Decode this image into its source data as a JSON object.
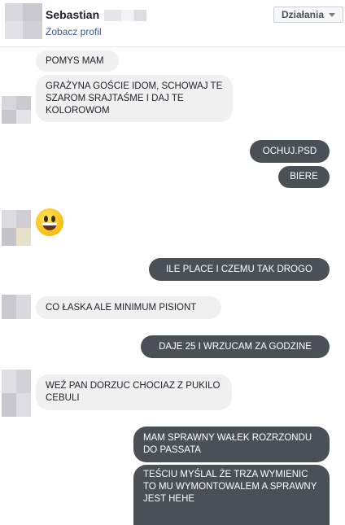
{
  "header": {
    "name": "Sebastian",
    "profile_link": "Zobacz profil",
    "actions_label": "Działania"
  },
  "messages": [
    "POMYS MAM",
    "GRAŻYNA GOŚCIE IDOM, SCHOWAJ TE SZAROM SRAJTAŚME I DAJ TE KOLOROWOM",
    "OCHUJ.PSD",
    "BIERE",
    "ILE PLACE I CZEMU TAK DROGO",
    "CO ŁASKA ALE MINIMUM PISIONT",
    "DAJE 25 I WRZUCAM ZA GODZINE",
    "WEŹ PAN DORZUC CHOCIAZ Z PUKILO CEBULI",
    "MAM SPRAWNY WAŁEK ROZRZONDU DO PASSATA",
    "TEŚCIU MYŚLAL ŻE TRZA WYMIENIC TO MU WYMONTOWALEM A SPRAWNY JEST HEHE"
  ],
  "emoji": "smiley-emoji",
  "colors": {
    "incoming_bubble": "#f1f0f0",
    "outgoing_bubble": "#4b4f56",
    "link": "#365899"
  }
}
